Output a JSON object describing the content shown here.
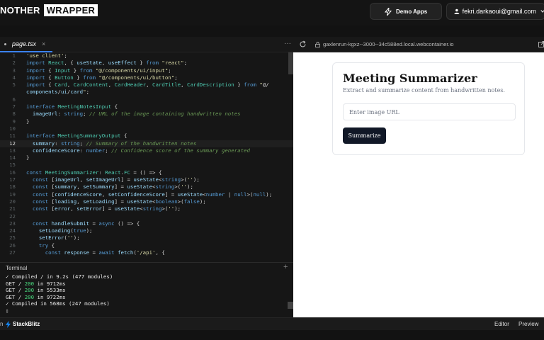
{
  "topbar": {
    "brand_part1": "NOTHER",
    "brand_part2": "WRAPPER",
    "demo_label": "Demo Apps",
    "account_email": "fekri.darkaoui@gmail.com"
  },
  "editor": {
    "tab_label": "page.tsx",
    "tab_close": "×",
    "more": "···",
    "current_line": 12,
    "lines": [
      {
        "n": "1",
        "text": "'use client';"
      },
      {
        "n": "2",
        "text": "import React, { useState, useEffect } from \"react\";"
      },
      {
        "n": "3",
        "text": "import { Input } from \"@/components/ui/input\";"
      },
      {
        "n": "4",
        "text": "import { Button } from \"@/components/ui/button\";"
      },
      {
        "n": "5",
        "text": "import { Card, CardContent, CardHeader, CardTitle, CardDescription } from \"@/"
      },
      {
        "n": "",
        "text": "components/ui/card\";"
      },
      {
        "n": "6",
        "text": ""
      },
      {
        "n": "7",
        "text": "interface MeetingNotesInput {"
      },
      {
        "n": "8",
        "text": "  imageUrl: string; // URL of the image containing handwritten notes"
      },
      {
        "n": "9",
        "text": "}"
      },
      {
        "n": "10",
        "text": ""
      },
      {
        "n": "11",
        "text": "interface MeetingSummaryOutput {"
      },
      {
        "n": "12",
        "text": "  summary: string; // Summary of the handwritten notes"
      },
      {
        "n": "13",
        "text": "  confidenceScore: number; // Confidence score of the summary generated"
      },
      {
        "n": "14",
        "text": "}"
      },
      {
        "n": "15",
        "text": ""
      },
      {
        "n": "16",
        "text": "const MeetingSummarizer: React.FC = () => {"
      },
      {
        "n": "17",
        "text": "  const [imageUrl, setImageUrl] = useState<string>('');"
      },
      {
        "n": "18",
        "text": "  const [summary, setSummary] = useState<string>('');"
      },
      {
        "n": "19",
        "text": "  const [confidenceScore, setConfidenceScore] = useState<number | null>(null);"
      },
      {
        "n": "20",
        "text": "  const [loading, setLoading] = useState<boolean>(false);"
      },
      {
        "n": "21",
        "text": "  const [error, setError] = useState<string>('');"
      },
      {
        "n": "22",
        "text": ""
      },
      {
        "n": "23",
        "text": "  const handleSubmit = async () => {"
      },
      {
        "n": "24",
        "text": "    setLoading(true);"
      },
      {
        "n": "25",
        "text": "    setError('');"
      },
      {
        "n": "26",
        "text": "    try {"
      },
      {
        "n": "27",
        "text": "      const response = await fetch('/api', {"
      }
    ]
  },
  "terminal": {
    "title": "Terminal",
    "plus": "+",
    "lines": [
      "✓ Compiled / in 9.2s (477 modules)",
      "GET / 200 in 9712ms",
      "GET / 200 in 5533ms",
      "GET / 200 in 9722ms",
      "✓ Compiled in 568ms (247 modules)",
      ""
    ]
  },
  "preview_bar": {
    "url": "gaxlenrun-kgxz--3000--34c588ed.local.webcontainer.io"
  },
  "app": {
    "title": "Meeting Summarizer",
    "description": "Extract and summarize content from handwritten notes.",
    "input_placeholder": "Enter image URL",
    "input_value": "",
    "button_label": "Summarize"
  },
  "bottombar": {
    "left_fragment": "n",
    "brand": "StackBlitz",
    "editor_label": "Editor",
    "preview_label": "Preview"
  },
  "colors": {
    "keyword": "#569cd6",
    "string": "#dcdcaa",
    "comment": "#6a9955",
    "type": "#4ec9b0",
    "number": "#b5cea8",
    "ident": "#9cdcfe",
    "plain": "#d4d4d4",
    "status_ok": "#4ade80"
  },
  "icons": [
    "bolt-icon",
    "user-icon",
    "chevron-down-icon",
    "reload-icon",
    "lock-icon",
    "external-link-icon",
    "stackblitz-logo-icon"
  ]
}
